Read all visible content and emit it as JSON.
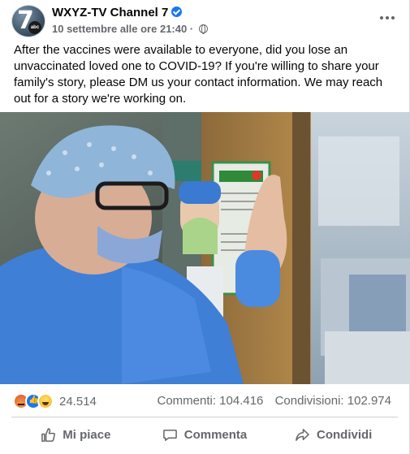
{
  "post": {
    "page_name": "WXYZ-TV Channel 7",
    "avatar_text": "7",
    "avatar_badge": "abc",
    "timestamp": "10 settembre alle ore 21:40",
    "separator": "·",
    "body": "After the vaccines were available to everyone, did you lose an unvaccinated loved one to COVID-19? If you're willing to share your family's story, please DM us your contact information. We may reach out for a story we're working on.",
    "verified_icon": "verified-badge-icon",
    "audience_icon": "globe-icon"
  },
  "engagement": {
    "reactions_count": "24.514",
    "reaction_icons": [
      "angry-reaction-icon",
      "like-reaction-icon",
      "haha-reaction-icon"
    ],
    "comments": "Commenti: 104.416",
    "shares": "Condivisioni: 102.974"
  },
  "actions": {
    "like": "Mi piace",
    "comment": "Commenta",
    "share": "Condividi"
  },
  "colors": {
    "accent": "#1877f2",
    "secondary_text": "#65676b",
    "divider": "#ced0d4"
  }
}
